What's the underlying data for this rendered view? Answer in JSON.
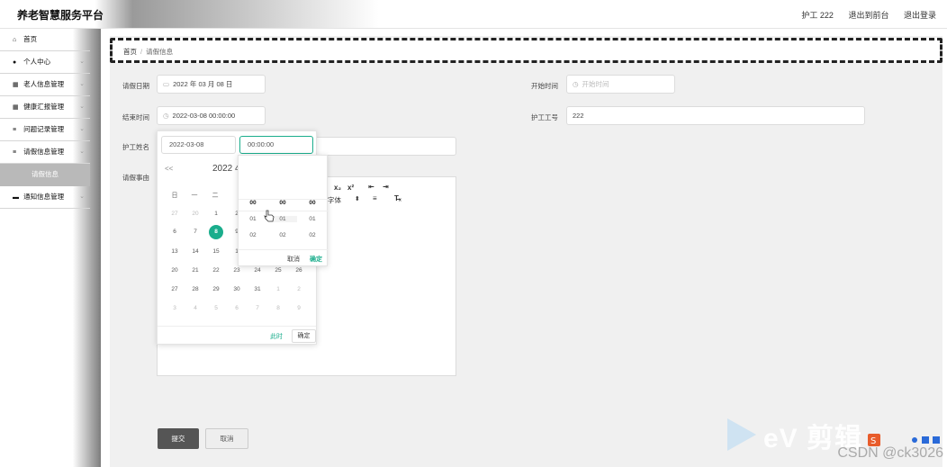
{
  "app": {
    "title": "养老智慧服务平台"
  },
  "header": {
    "user": "护工 222",
    "exit_front": "退出到前台",
    "logout": "退出登录"
  },
  "sidebar": {
    "items": [
      {
        "icon": "home-icon",
        "glyph": "⌂",
        "label": "首页",
        "chevron": ""
      },
      {
        "icon": "user-icon",
        "glyph": "●",
        "label": "个人中心",
        "chevron": "⌄"
      },
      {
        "icon": "grid-icon",
        "glyph": "▦",
        "label": "老人信息管理",
        "chevron": "⌄"
      },
      {
        "icon": "grid-icon",
        "glyph": "▦",
        "label": "健康汇报管理",
        "chevron": "⌄"
      },
      {
        "icon": "list-icon",
        "glyph": "≡",
        "label": "问题记录管理",
        "chevron": "⌄"
      },
      {
        "icon": "list-icon",
        "glyph": "≡",
        "label": "请假信息管理",
        "chevron": "⌄"
      },
      {
        "icon": "",
        "glyph": "",
        "label": "请假信息",
        "chevron": ""
      },
      {
        "icon": "message-icon",
        "glyph": "▬",
        "label": "通知信息管理",
        "chevron": "⌄"
      }
    ]
  },
  "breadcrumb": {
    "home": "首页",
    "sep": "/",
    "current": "请假信息"
  },
  "form": {
    "leave_date": {
      "label": "请假日期",
      "value": "2022 年 03 月 08 日"
    },
    "start_time": {
      "label": "开始时间",
      "placeholder": "开始时间"
    },
    "end_time": {
      "label": "结束时间",
      "value": "2022-03-08 00:00:00"
    },
    "worker_no": {
      "label": "护工工号",
      "value": "222"
    },
    "worker_name": {
      "label": "护工姓名"
    },
    "reason": {
      "label": "请假事由"
    }
  },
  "editor": {
    "toolbar": {
      "sub": "x₂",
      "sup": "x²",
      "indent_out": "⇤",
      "indent_in": "⇥",
      "font": "字体",
      "font_caret": "⬍",
      "align": "≡",
      "clear": "T̶ₓ"
    }
  },
  "buttons": {
    "submit": "提交",
    "cancel": "取消"
  },
  "datepicker": {
    "date_input": "2022-03-08",
    "time_input": "00:00:00",
    "prev": "<<",
    "year_month": "2022 4",
    "weekdays": [
      "日",
      "一",
      "二"
    ],
    "rows": [
      [
        "27",
        "20",
        "1",
        "2"
      ],
      [
        "6",
        "7",
        "8",
        "9"
      ],
      [
        "13",
        "14",
        "15",
        "1",
        "",
        "",
        "",
        ""
      ],
      [
        "20",
        "21",
        "22",
        "23",
        "24",
        "25",
        "26"
      ],
      [
        "27",
        "28",
        "29",
        "30",
        "31",
        "1",
        "2"
      ],
      [
        "3",
        "4",
        "5",
        "6",
        "7",
        "8",
        "9"
      ]
    ],
    "now": "此时",
    "ok": "确定"
  },
  "timepicker": {
    "hours": [
      "00",
      "01",
      "02"
    ],
    "minutes": [
      "00",
      "01",
      "02"
    ],
    "seconds": [
      "00",
      "01",
      "02"
    ],
    "cancel": "取消",
    "confirm": "确定"
  },
  "watermark": {
    "csdn": "CSDN @ck3026",
    "ev": "eV 剪辑"
  },
  "colors": {
    "accent": "#1aad8c",
    "sidebar_active": "#b9b9b9",
    "submit_bg": "#555555"
  }
}
